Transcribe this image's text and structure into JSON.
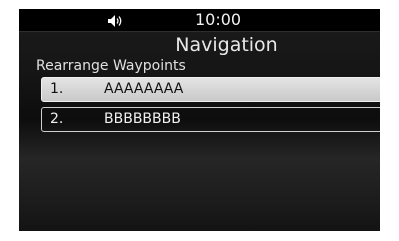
{
  "status_bar": {
    "volume_icon": "volume-icon",
    "time": "10:00"
  },
  "header": {
    "title": "Navigation",
    "subtitle": "Rearrange Waypoints"
  },
  "waypoints": [
    {
      "number": "1.",
      "name": "AAAAAAAA",
      "selected": true
    },
    {
      "number": "2.",
      "name": "BBBBBBBB",
      "selected": false
    }
  ],
  "colors": {
    "background": "#161616",
    "selected_fill": "#d6d6d6",
    "text": "#f0f0f0"
  }
}
